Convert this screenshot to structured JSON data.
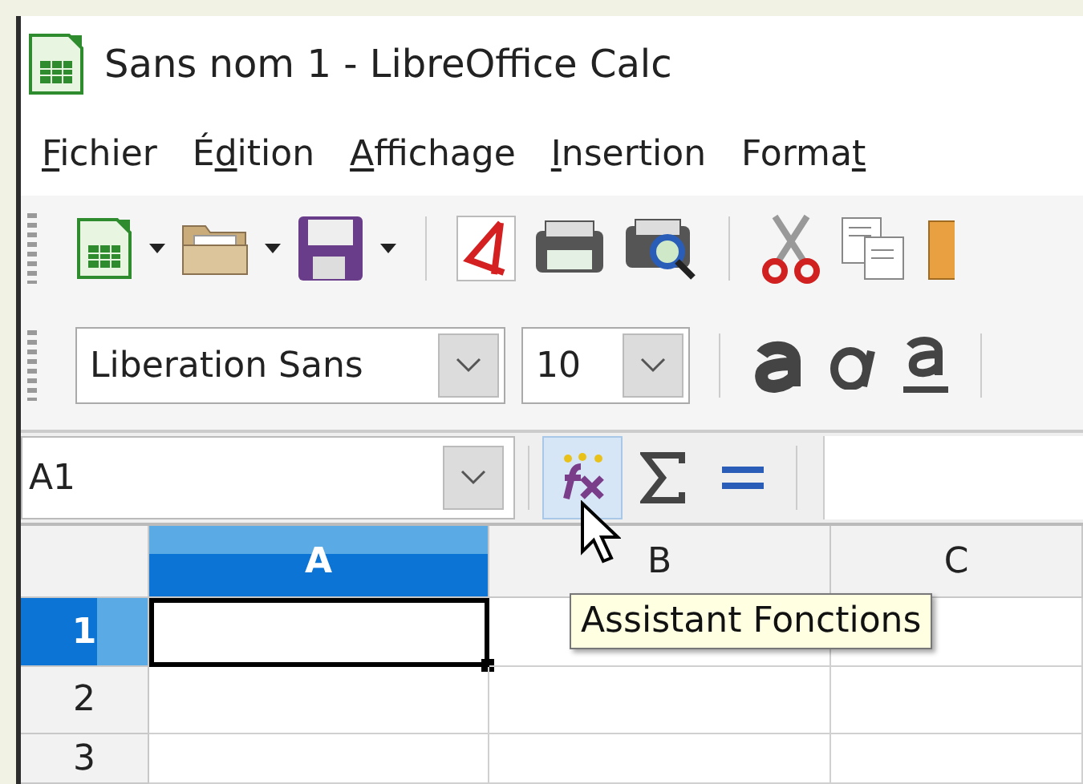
{
  "window": {
    "title": "Sans nom 1 - LibreOffice Calc"
  },
  "menu": [
    {
      "key": "F",
      "after": "ichier"
    },
    {
      "before": "É",
      "key": "d",
      "after": "ition"
    },
    {
      "key": "A",
      "after": "ffichage"
    },
    {
      "key": "I",
      "after": "nsertion"
    },
    {
      "before": "Forma",
      "key": "t"
    }
  ],
  "formatting": {
    "font": "Liberation Sans",
    "size": "10"
  },
  "formula_bar": {
    "name_box": "A1",
    "buttons": [
      {
        "kind": "wizard",
        "hovered": true
      },
      {
        "kind": "sum",
        "hovered": false
      },
      {
        "kind": "formula",
        "hovered": false
      }
    ]
  },
  "sheet": {
    "columns": [
      {
        "label": "A",
        "selected": true
      },
      {
        "label": "B",
        "selected": false
      },
      {
        "label": "C",
        "selected": false
      }
    ],
    "rows": [
      {
        "label": "1",
        "selected": true
      },
      {
        "label": "2",
        "selected": false
      },
      {
        "label": "3",
        "selected": false
      }
    ]
  },
  "tooltip": "Assistant Fonctions"
}
